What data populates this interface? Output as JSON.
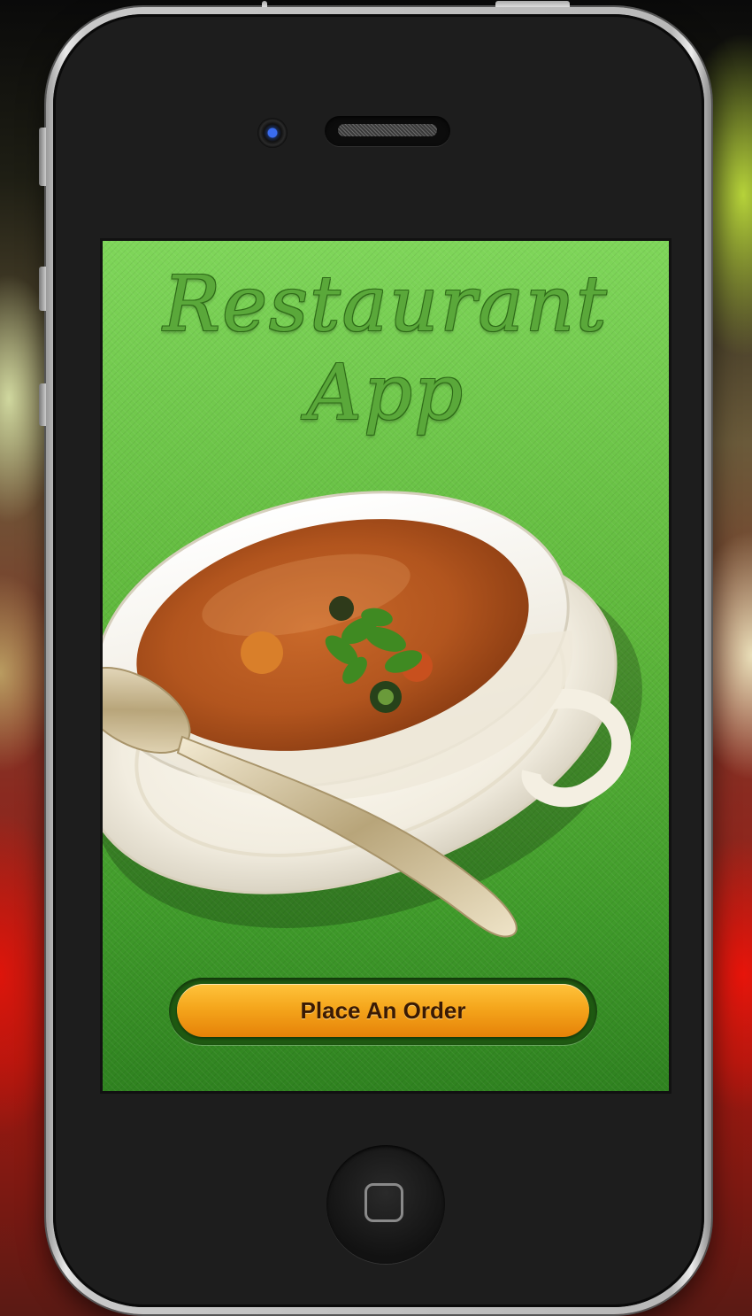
{
  "app": {
    "title": "Restaurant App",
    "order_button_label": "Place An Order"
  },
  "colors": {
    "background_green": "#5fb83c",
    "title_green": "#5aa83a",
    "button_orange": "#f5a61c",
    "button_text": "#3a1a04",
    "phone_body": "#1d1d1d"
  },
  "icons": {
    "camera": "camera-icon",
    "speaker": "speaker-icon",
    "home": "home-button-icon"
  }
}
